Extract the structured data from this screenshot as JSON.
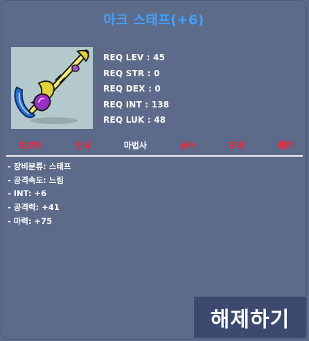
{
  "item": {
    "name": "아크 스태프(+6)",
    "icon": "staff-icon",
    "requirements": [
      {
        "label": "REQ LEV",
        "value": "45"
      },
      {
        "label": "REQ STR",
        "value": "0"
      },
      {
        "label": "REQ DEX",
        "value": "0"
      },
      {
        "label": "REQ INT",
        "value": "138"
      },
      {
        "label": "REQ LUK",
        "value": "48"
      }
    ],
    "jobs": [
      {
        "label": "초보자",
        "allowed": false
      },
      {
        "label": "전사",
        "allowed": false
      },
      {
        "label": "마법사",
        "allowed": true
      },
      {
        "label": "궁수",
        "allowed": false
      },
      {
        "label": "도적",
        "allowed": false
      },
      {
        "label": "해적",
        "allowed": false
      }
    ],
    "stats": [
      "- 장비분류: 스태프",
      "- 공격속도: 느림",
      "- INT: +6",
      "- 공격력: +41",
      "- 마력: +75"
    ]
  },
  "actions": {
    "dismantle_label": "해제하기"
  },
  "colors": {
    "title": "#3fa2ff",
    "job_allowed": "#ffffff",
    "job_denied": "#ff1f2f",
    "panel": "#5c6b8a",
    "button": "#3c4a6f"
  }
}
